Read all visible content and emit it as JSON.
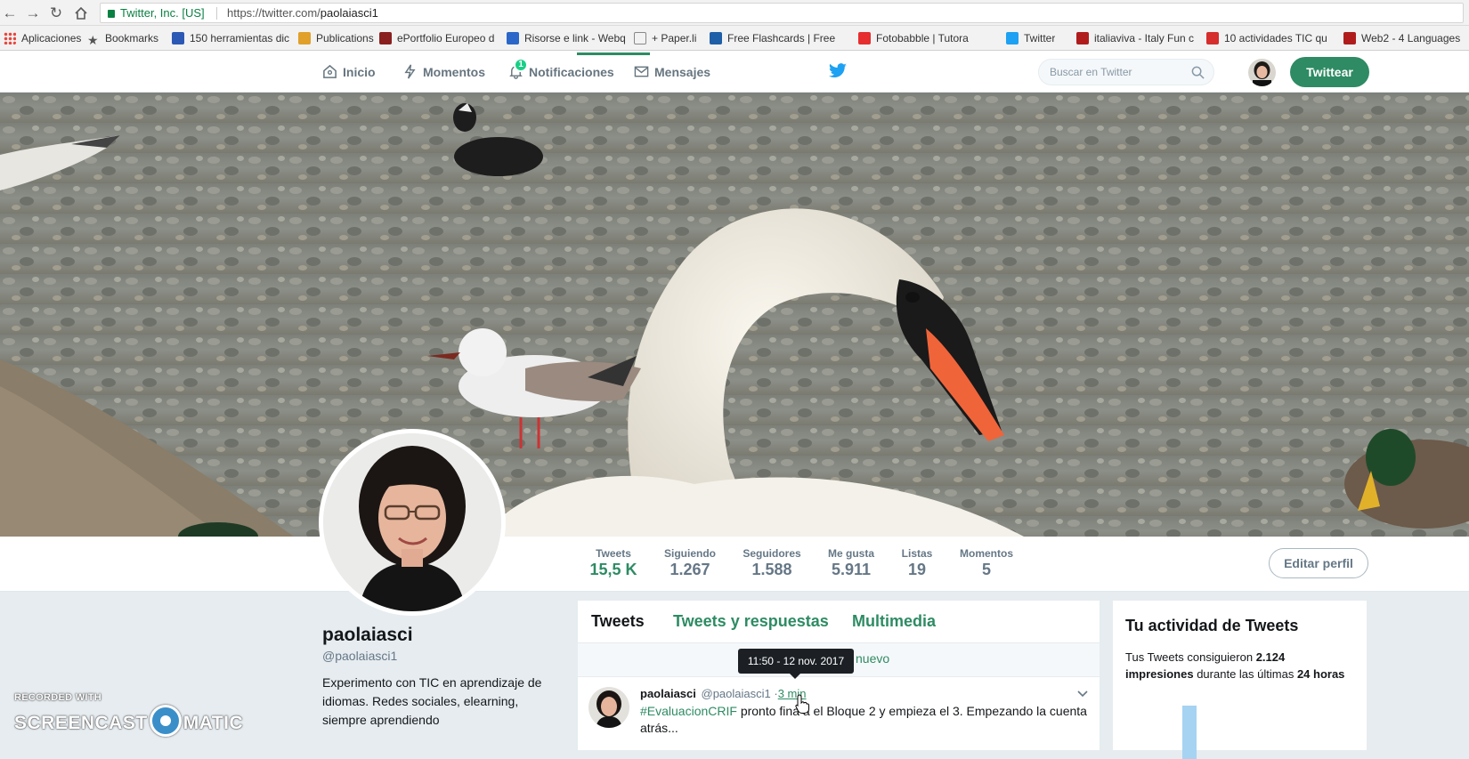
{
  "browser": {
    "site_identity": "Twitter, Inc. [US]",
    "url_prefix": "https://twitter.com/",
    "url_path": "paolaiasci1",
    "bookmarks": [
      {
        "label": "Aplicaciones",
        "icon": "apps-grid-icon",
        "color": "#4285f4"
      },
      {
        "label": "Bookmarks",
        "icon": "star-icon",
        "color": "#555555"
      },
      {
        "label": "150 herramientas dic",
        "icon": "bookmark-favicon",
        "color": "#2b58b5"
      },
      {
        "label": "Publications",
        "icon": "bookmark-favicon",
        "color": "#e0a02a"
      },
      {
        "label": "ePortfolio Europeo d",
        "icon": "bookmark-favicon",
        "color": "#8a1f1f"
      },
      {
        "label": "Risorse e link - Webq",
        "icon": "bookmark-favicon",
        "color": "#2a67c9"
      },
      {
        "label": "+ Paper.li",
        "icon": "page-icon",
        "color": "#888888"
      },
      {
        "label": "Free Flashcards | Free",
        "icon": "check-icon",
        "color": "#1f5fa8"
      },
      {
        "label": "Fotobabble | Tutora",
        "icon": "bookmark-favicon",
        "color": "#e62e2e"
      },
      {
        "label": "Twitter",
        "icon": "twitter-bird-icon",
        "color": "#1da1f2"
      },
      {
        "label": "italiaviva - Italy Fun c",
        "icon": "bookmark-favicon",
        "color": "#b01c1c"
      },
      {
        "label": "10 actividades TIC qu",
        "icon": "bookmark-favicon",
        "color": "#d62d2d"
      },
      {
        "label": "Web2 - 4 Languages",
        "icon": "bookmark-favicon",
        "color": "#b01c1c"
      }
    ]
  },
  "nav": {
    "home": "Inicio",
    "moments": "Momentos",
    "notifications": "Notificaciones",
    "notifications_count": "1",
    "messages": "Mensajes",
    "search_placeholder": "Buscar en Twitter",
    "tweet_button": "Twittear"
  },
  "profile": {
    "stats": [
      {
        "label": "Tweets",
        "value": "15,5 K",
        "active": true
      },
      {
        "label": "Siguiendo",
        "value": "1.267"
      },
      {
        "label": "Seguidores",
        "value": "1.588"
      },
      {
        "label": "Me gusta",
        "value": "5.911"
      },
      {
        "label": "Listas",
        "value": "19"
      },
      {
        "label": "Momentos",
        "value": "5"
      }
    ],
    "edit_button": "Editar perfil",
    "name": "paolaiasci",
    "handle": "@paolaiasci1",
    "bio": "Experimento con TIC en aprendizaje de idiomas. Redes sociales, elearning, siempre aprendiendo"
  },
  "timeline": {
    "tabs": [
      "Tweets",
      "Tweets y respuestas",
      "Multimedia"
    ],
    "new_tweets_text": "nuevo",
    "tooltip": "11:50 - 12 nov. 2017",
    "tweet": {
      "author": "paolaiasci",
      "handle": "@paolaiasci1",
      "separator": "·",
      "time": "3 min",
      "hashtag": "#EvaluacionCRIF",
      "text": " pronto fina  a el Bloque 2 y empieza el 3. Empezando la cuenta atrás..."
    }
  },
  "activity": {
    "title": "Tu actividad de Tweets",
    "text_pre": "Tus Tweets consiguieron ",
    "impressions": "2.124",
    "text_mid": " impresiones",
    "text_post": " durante las últimas ",
    "hours": "24 horas"
  },
  "watermark": {
    "small": "RECORDED WITH",
    "left": "SCREENCAST",
    "right": "MATIC"
  },
  "colors": {
    "accent": "#2e8b63",
    "twitter_blue": "#1da1f2",
    "notification_badge": "#19cf86"
  }
}
